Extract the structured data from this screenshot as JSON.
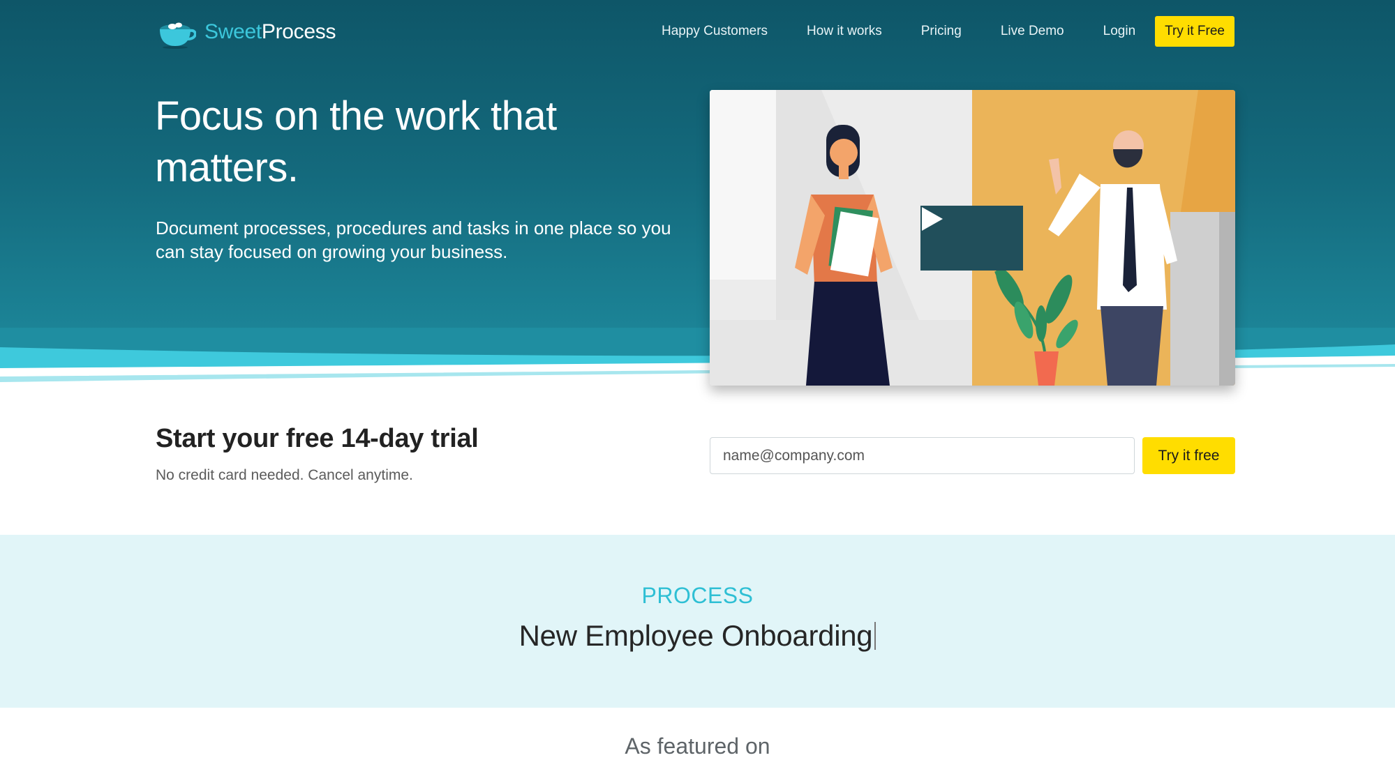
{
  "brand": {
    "name_part1": "Sweet",
    "name_part2": "Process",
    "logo_icon": "teacup-icon",
    "accent_color": "#3cc7dc"
  },
  "nav": {
    "links": [
      "Happy Customers",
      "How it works",
      "Pricing",
      "Live Demo",
      "Login"
    ],
    "cta_label": "Try it Free"
  },
  "hero": {
    "title": "Focus on the work that matters.",
    "subtitle": "Document processes, procedures and tasks in one place so you can stay focused on growing your business.",
    "video_play_icon": "play-icon"
  },
  "trial": {
    "title": "Start your free 14-day trial",
    "subtitle": "No credit card needed. Cancel anytime.",
    "email_placeholder": "name@company.com",
    "button_label": "Try it free",
    "button_color": "#ffdd00"
  },
  "process": {
    "eyebrow": "PROCESS",
    "typed_text": "New Employee Onboarding"
  },
  "featured": {
    "heading": "As featured on"
  }
}
